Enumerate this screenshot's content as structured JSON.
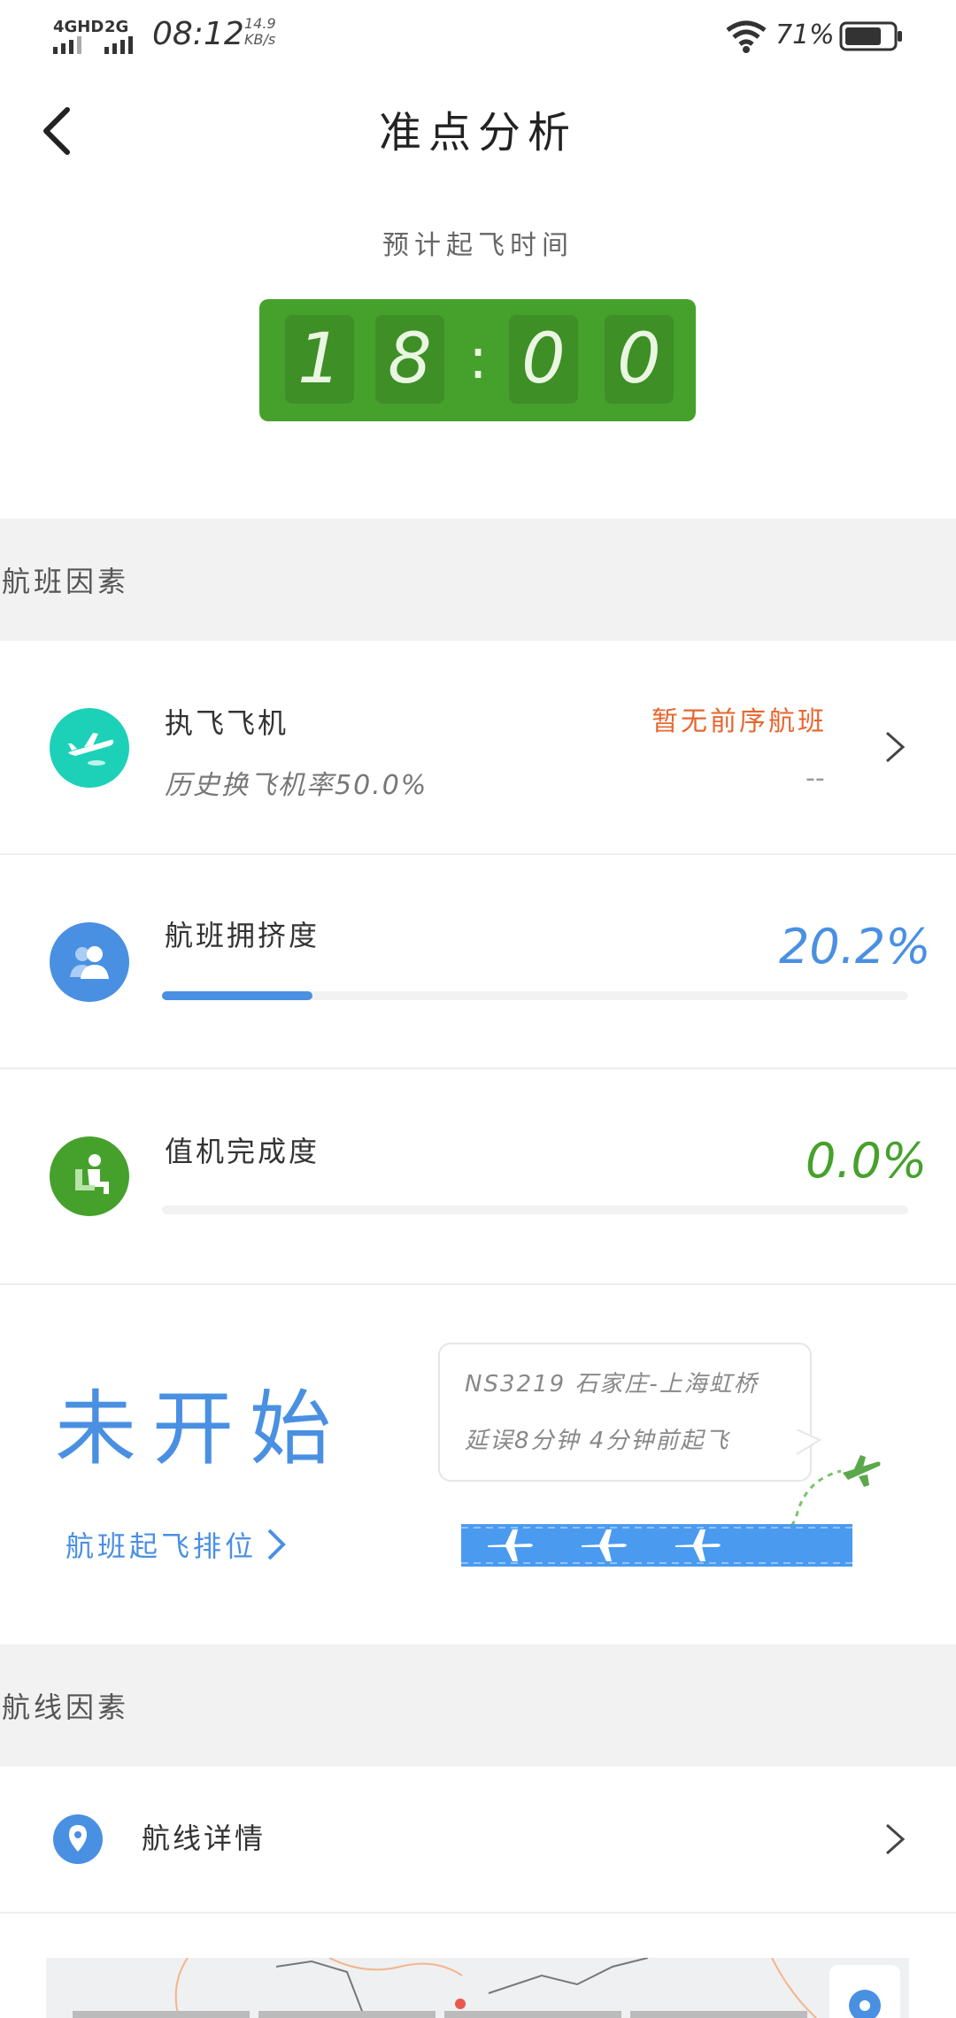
{
  "status_bar": {
    "signal_1": "4GHD",
    "signal_2": "2G",
    "time": "08:12",
    "speed_value": "14.9",
    "speed_unit": "KB/s",
    "battery_pct": "71%"
  },
  "header": {
    "title": "准点分析"
  },
  "departure": {
    "label": "预计起飞时间",
    "digits": [
      "1",
      "8",
      ":",
      "0",
      "0"
    ]
  },
  "sections": {
    "flight_factors": "航班因素",
    "route_factors": "航线因素"
  },
  "aircraft": {
    "title": "执飞飞机",
    "sub": "历史换飞机率50.0%",
    "status": "暂无前序航班",
    "value": "--"
  },
  "crowding": {
    "title": "航班拥挤度",
    "value": "20.2%",
    "progress_fraction": 0.202
  },
  "checkin": {
    "title": "值机完成度",
    "value": "0.0%",
    "progress_fraction": 0.0
  },
  "ranking": {
    "status": "未开始",
    "link": "航班起飞排位",
    "bubble_line1": "NS3219 石家庄-上海虹桥",
    "bubble_line2": "延误8分钟 4分钟前起飞"
  },
  "route": {
    "title": "航线详情"
  },
  "colors": {
    "accent_blue": "#4a90e2",
    "green": "#46a12c",
    "teal": "#1dd1b8",
    "orange": "#e8662e"
  }
}
